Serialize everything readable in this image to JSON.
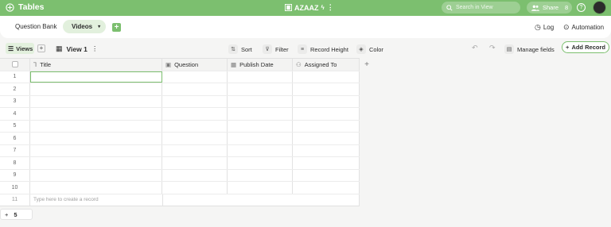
{
  "app": {
    "title": "Tables",
    "base_name": "AZAAZ"
  },
  "search": {
    "placeholder": "Search in View"
  },
  "share": {
    "label": "Share",
    "count": "8"
  },
  "tabs": [
    {
      "label": "Question Bank"
    },
    {
      "label": "Videos"
    }
  ],
  "header_actions": {
    "log": "Log",
    "automation": "Automation"
  },
  "toolbar": {
    "views_label": "Views",
    "view_name": "View 1",
    "sort": "Sort",
    "filter": "Filter",
    "record_height": "Record Height",
    "color": "Color",
    "manage_fields": "Manage fields",
    "add_record": "Add Record"
  },
  "columns": [
    {
      "label": "Title",
      "icon": "text-field-icon"
    },
    {
      "label": "Question",
      "icon": "link-field-icon"
    },
    {
      "label": "Publish Date",
      "icon": "date-field-icon"
    },
    {
      "label": "Assigned To",
      "icon": "user-field-icon"
    }
  ],
  "rows": [
    "1",
    "2",
    "3",
    "4",
    "5",
    "6",
    "7",
    "8",
    "9",
    "10"
  ],
  "new_row": {
    "number": "11",
    "placeholder": "Type here to create a record"
  },
  "footer": {
    "count": "5"
  },
  "colors": {
    "brand": "#7cbf6f",
    "active_tab": "#e2f0dd"
  }
}
